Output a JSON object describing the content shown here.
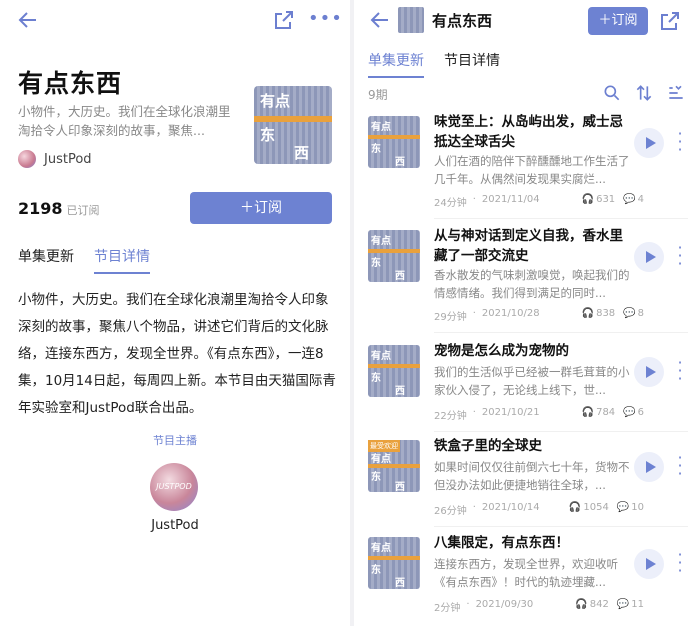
{
  "left": {
    "title": "有点东西",
    "description": "小物件，大历史。我们在全球化浪潮里淘拾令人印象深刻的故事，聚焦...",
    "host_name": "JustPod",
    "subscriber_count": "2198",
    "subscriber_label": "已订阅",
    "subscribe_label": "＋订阅",
    "tabs": [
      "单集更新",
      "节目详情"
    ],
    "body": "小物件，大历史。我们在全球化浪潮里淘拾令人印象深刻的故事，聚焦八个物品，讲述它们背后的文化脉络，连接东西方，发现全世界。《有点东西》，一连8集，10月14日起，每周四上新。本节目由天猫国际青年实验室和JustPod联合出品。",
    "host_section_label": "节目主播",
    "host_avatar_text": "JUSTPOD",
    "host_name_lg": "JustPod"
  },
  "cover": {
    "line1": "有点",
    "line2": "东",
    "line3": "西"
  },
  "right": {
    "title": "有点东西",
    "subscribe_label": "＋订阅",
    "tabs": [
      "单集更新",
      "节目详情"
    ],
    "episode_count": "9期",
    "episodes": [
      {
        "title": "味觉至上：从岛屿出发，威士忌抵达全球舌尖",
        "desc": "人们在酒的陪伴下醉醺醺地工作生活了几千年。从偶然间发现果实腐烂...",
        "duration": "24分钟",
        "date": "2021/11/04",
        "plays": "631",
        "comments": "4",
        "badge": ""
      },
      {
        "title": "从与神对话到定义自我，香水里藏了一部交流史",
        "desc": "香水散发的气味刺激嗅觉，唤起我们的情感情绪。我们得到满足的同时...",
        "duration": "29分钟",
        "date": "2021/10/28",
        "plays": "838",
        "comments": "8",
        "badge": ""
      },
      {
        "title": "宠物是怎么成为宠物的",
        "desc": "我们的生活似乎已经被一群毛茸茸的小家伙入侵了，无论线上线下，世...",
        "duration": "22分钟",
        "date": "2021/10/21",
        "plays": "784",
        "comments": "6",
        "badge": ""
      },
      {
        "title": "铁盒子里的全球史",
        "desc": "如果时间仅仅往前倒六七十年，货物不但没办法如此便捷地销往全球，...",
        "duration": "26分钟",
        "date": "2021/10/14",
        "plays": "1054",
        "comments": "10",
        "badge": "最受欢迎"
      },
      {
        "title": "八集限定，有点东西！",
        "desc": "连接东西方，发现全世界，欢迎收听《有点东西》！时代的轨迹埋藏...",
        "duration": "2分钟",
        "date": "2021/09/30",
        "plays": "842",
        "comments": "11",
        "badge": ""
      }
    ]
  }
}
